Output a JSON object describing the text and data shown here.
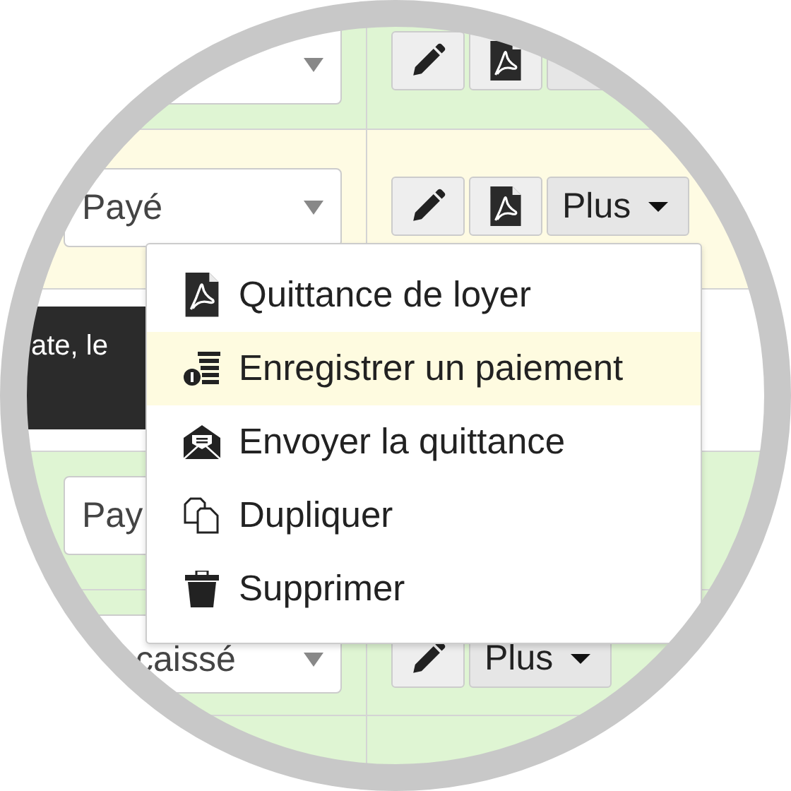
{
  "rows": [
    {
      "color": "#dff5d3",
      "buttons": [
        {
          "kind": "edit"
        },
        {
          "kind": "pdf"
        },
        {
          "kind": "more"
        }
      ]
    },
    {
      "color": "#fefbe3",
      "status": "Payé",
      "buttons": [
        {
          "kind": "edit"
        },
        {
          "kind": "pdf"
        },
        {
          "kind": "more",
          "label": "Plus"
        }
      ]
    },
    {
      "color": "#ffffff",
      "tooltip": "ate, le"
    },
    {
      "color": "#dff5d3",
      "status": "Pay"
    },
    {
      "color": "#dff5d3",
      "status": "caissé",
      "buttons": [
        {
          "kind": "edit"
        },
        {
          "kind": "more",
          "label": "Plus"
        }
      ]
    },
    {
      "color": "#dff5d3"
    }
  ],
  "menu": {
    "items": [
      {
        "kind": "pdf",
        "label": "Quittance de loyer",
        "highlighted": false
      },
      {
        "kind": "payment",
        "label": "Enregistrer un paiement",
        "highlighted": true
      },
      {
        "kind": "mail",
        "label": "Envoyer la quittance",
        "highlighted": false
      },
      {
        "kind": "copy",
        "label": "Dupliquer",
        "highlighted": false
      },
      {
        "kind": "trash",
        "label": "Supprimer",
        "highlighted": false
      }
    ]
  }
}
